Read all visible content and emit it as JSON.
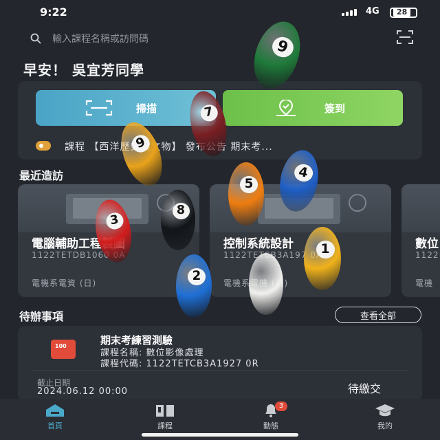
{
  "status": {
    "time": "9:22",
    "network": "4G",
    "battery": "28"
  },
  "search": {
    "placeholder": "輸入課程名稱或訪問碼"
  },
  "greeting": "早安！ 吳宜芳同學",
  "actions": {
    "scan_label": "掃描",
    "checkin_label": "簽到"
  },
  "notice": {
    "text": "課程 【西洋歷史與文物】 發布公告 期末考..."
  },
  "recent": {
    "title": "最近造訪",
    "courses": [
      {
        "name": "電腦輔助工程製圖",
        "code": "1122TETDB1060 0A",
        "dept": "電機系電資 (日)"
      },
      {
        "name": "控制系統設計",
        "code": "1122TETCB3A197 0A",
        "dept": "電機系電機 (日)"
      },
      {
        "name": "數位",
        "code": "1122",
        "dept": "電機"
      }
    ]
  },
  "todo": {
    "title": "待辦事項",
    "view_all": "查看全部",
    "item": {
      "icon_text": "100",
      "title": "期末考練習測驗",
      "course_name": "課程名稱: 數位影像處理",
      "course_code": "課程代碼: 1122TETCB3A1927 0R",
      "deadline_label": "截止日期",
      "deadline_value": "2024.06.12 00:00",
      "status": "待繳交"
    }
  },
  "tabs": [
    {
      "label": "首頁",
      "icon": "home-icon",
      "active": true
    },
    {
      "label": "課程",
      "icon": "book-icon",
      "active": false
    },
    {
      "label": "動態",
      "icon": "bell-icon",
      "active": false,
      "badge": "3"
    },
    {
      "label": "我的",
      "icon": "graduation-cap-icon",
      "active": false
    }
  ],
  "overlay_balls": [
    {
      "number": "9",
      "color": "#1f7a3a"
    },
    {
      "number": "7",
      "color": "#7a1e22"
    },
    {
      "number": "9",
      "color": "#e9a21a"
    },
    {
      "number": "4",
      "color": "#1f5fc6"
    },
    {
      "number": "5",
      "color": "#ef7d10"
    },
    {
      "number": "3",
      "color": "#d31c1c"
    },
    {
      "number": "8",
      "color": "#111418"
    },
    {
      "number": "1",
      "color": "#f0b21a"
    },
    {
      "number": "2",
      "color": "#1e6fd6"
    },
    {
      "number": "",
      "color": "#f1f1ee"
    }
  ]
}
